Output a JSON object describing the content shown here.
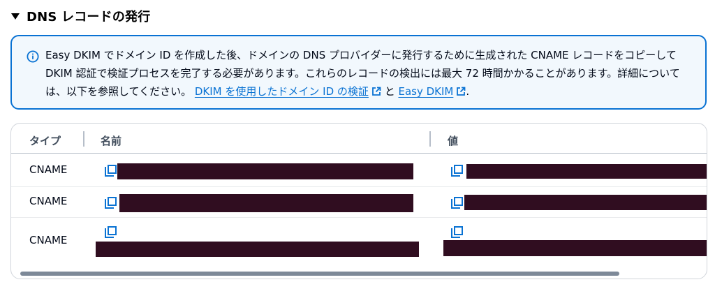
{
  "section": {
    "title": "DNS レコードの発行",
    "expanded": true
  },
  "alert": {
    "type": "info",
    "text_before": "Easy DKIM でドメイン ID を作成した後、ドメインの DNS プロバイダーに発行するために生成された CNAME レコードをコピーして DKIM 認証で検証プロセスを完了する必要があります。これらのレコードの検出には最大 72 時間かかることがあります。詳細については、以下を参照してください。 ",
    "link1": "DKIM を使用したドメイン ID の検証",
    "between": " と ",
    "link2": "Easy DKIM",
    "after": "."
  },
  "table": {
    "columns": [
      "タイプ",
      "名前",
      "値"
    ],
    "rows": [
      {
        "type": "CNAME",
        "name": "[redacted]",
        "value": "[redacted]"
      },
      {
        "type": "CNAME",
        "name": "[redacted]",
        "value": "[redacted]"
      },
      {
        "type": "CNAME",
        "name": "[redacted]",
        "value": "[redacted]"
      }
    ]
  },
  "colors": {
    "accent": "#0972d3",
    "alert_bg": "#f2f8fd",
    "redaction": "#300d20"
  }
}
